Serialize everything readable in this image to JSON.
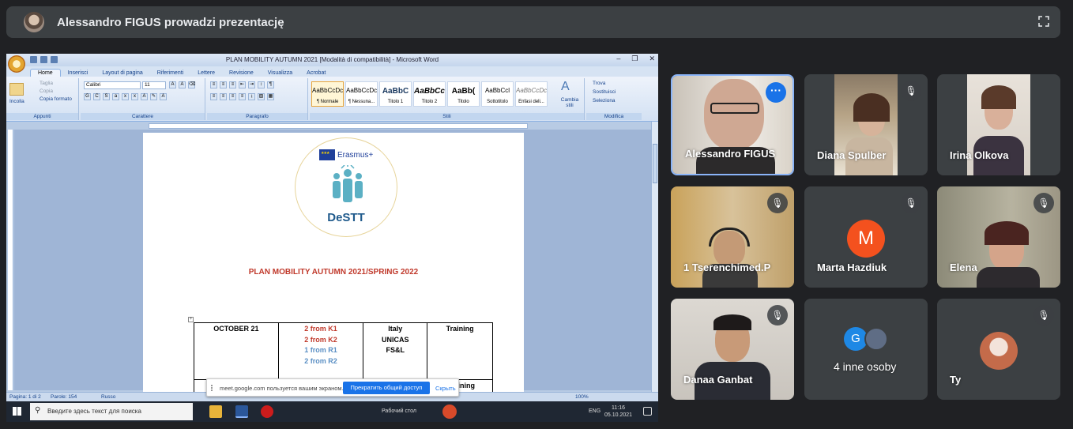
{
  "meeting": {
    "presenter_banner": "Alessandro FIGUS prowadzi prezentację"
  },
  "word": {
    "window_title": "PLAN MOBILITY AUTUMN 2021 [Modalità di compatibilità] - Microsoft Word",
    "tabs": [
      "Home",
      "Inserisci",
      "Layout di pagina",
      "Riferimenti",
      "Lettere",
      "Revisione",
      "Visualizza",
      "Acrobat"
    ],
    "clipboard": {
      "paste": "Incolla",
      "cut": "Taglia",
      "copy": "Copia",
      "format_painter": "Copia formato",
      "label": "Appunti"
    },
    "font": {
      "name": "Calibri",
      "size": "11",
      "label": "Carattere"
    },
    "paragraph_label": "Paragrafo",
    "styles": [
      {
        "sample": "AaBbCcDc",
        "name": "¶ Normale"
      },
      {
        "sample": "AaBbCcDc",
        "name": "¶ Nessuna..."
      },
      {
        "sample": "AaBbC",
        "name": "Titolo 1"
      },
      {
        "sample": "AaBbCc",
        "name": "Titolo 2"
      },
      {
        "sample": "AaBb(",
        "name": "Titolo"
      },
      {
        "sample": "AaBbCcl",
        "name": "Sottotitolo"
      },
      {
        "sample": "AaBbCcDc",
        "name": "Enfasi deli..."
      }
    ],
    "styles_label": "Stili",
    "change_styles": "Cambia stili",
    "editing": {
      "find": "Trova",
      "replace": "Sostituisci",
      "select": "Seleziona",
      "label": "Modifica"
    },
    "document": {
      "logo_text": "Erasmus+",
      "logo_name": "DeSTT",
      "plan_title": "PLAN MOBILITY AUTUMN 2021/SPRING 2022",
      "table": {
        "month": "OCTOBER 21",
        "from_k1": "2 from K1",
        "from_k2": "2 from K2",
        "from_r1": "1 from R1",
        "from_r2": "2 from R2",
        "country": "Italy",
        "university": "UNICAS",
        "dept": "FS&L",
        "type": "Training",
        "type2": "ining"
      }
    },
    "status": {
      "page": "Pagina: 1 di 2",
      "words": "Parole: 154",
      "lang": "Russo",
      "zoom": "100%"
    }
  },
  "share_bar": {
    "message": "meet.google.com пользуется вашим экраном.",
    "stop": "Прекратить общий доступ",
    "hide": "Скрыть"
  },
  "taskbar": {
    "search_placeholder": "Введите здесь текст для поиска",
    "desktop": "Рабочий стол",
    "lang": "ENG",
    "time": "11:16",
    "date": "05.10.2021"
  },
  "participants": [
    {
      "name": "Alessandro FIGUS"
    },
    {
      "name": "Diana Spulber"
    },
    {
      "name": "Irina Olkova"
    },
    {
      "name": "1 Tserenchimed.P"
    },
    {
      "name": "Marta Hazdiuk",
      "initial": "M"
    },
    {
      "name": "Elena"
    },
    {
      "name": "Danaa Ganbat"
    },
    {
      "name": "4 inne osoby",
      "initial": "G"
    },
    {
      "name": "Ty"
    }
  ],
  "colors": {
    "meet_bg": "#202124",
    "tile_bg": "#3c4043",
    "accent_blue": "#1a73e8",
    "plan_red": "#c0392b",
    "plan_blue": "#5a8fc4"
  }
}
